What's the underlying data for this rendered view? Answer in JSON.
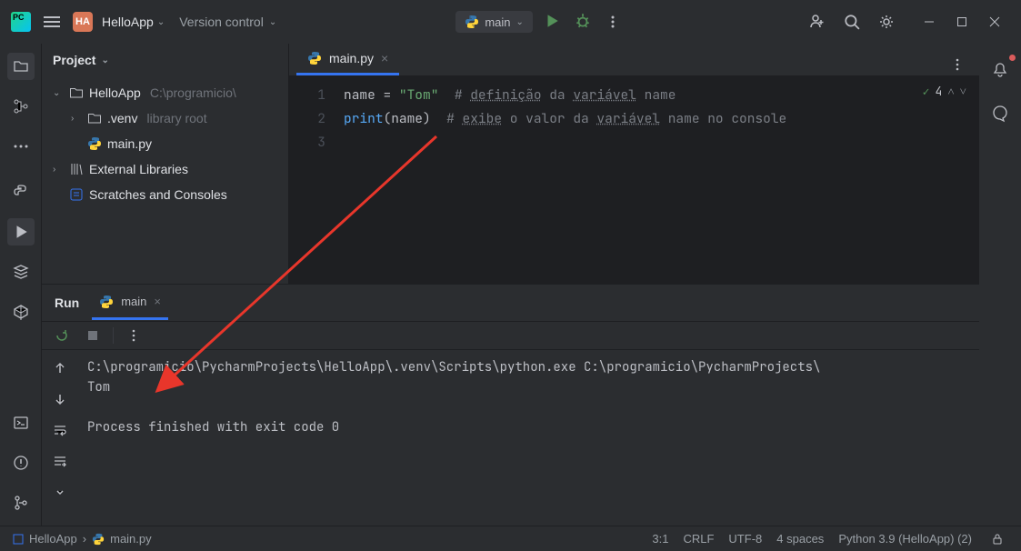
{
  "titlebar": {
    "project_badge": "HA",
    "project_name": "HelloApp",
    "vcs_label": "Version control",
    "run_config": "main"
  },
  "project_panel": {
    "title": "Project",
    "root_name": "HelloApp",
    "root_path": "C:\\programicio\\",
    "venv": ".venv",
    "venv_hint": "library root",
    "main_file": "main.py",
    "external": "External Libraries",
    "scratches": "Scratches and Consoles"
  },
  "editor": {
    "tab_name": "main.py",
    "lines": [
      "1",
      "2",
      "3"
    ],
    "code": {
      "l1_a": "name = ",
      "l1_str": "\"Tom\"",
      "l1_pad": "  ",
      "l1_c": "# ",
      "l1_u1": "definição",
      "l1_mid": " da ",
      "l1_u2": "variável",
      "l1_end": " name",
      "l2_fn": "print",
      "l2_a": "(name)",
      "l2_pad": "  ",
      "l2_c": "# ",
      "l2_u1": "exibe",
      "l2_mid": " o valor da ",
      "l2_u2": "variável",
      "l2_end": " name no console"
    },
    "inspect_count": "4"
  },
  "run": {
    "title": "Run",
    "tab": "main",
    "output_cmd": "C:\\programicio\\PycharmProjects\\HelloApp\\.venv\\Scripts\\python.exe C:\\programicio\\PycharmProjects\\",
    "output_result": "Tom",
    "output_exit": "Process finished with exit code 0"
  },
  "status": {
    "crumb_root": "HelloApp",
    "crumb_file": "main.py",
    "pos": "3:1",
    "eol": "CRLF",
    "enc": "UTF-8",
    "indent": "4 spaces",
    "interp": "Python 3.9 (HelloApp) (2)"
  }
}
